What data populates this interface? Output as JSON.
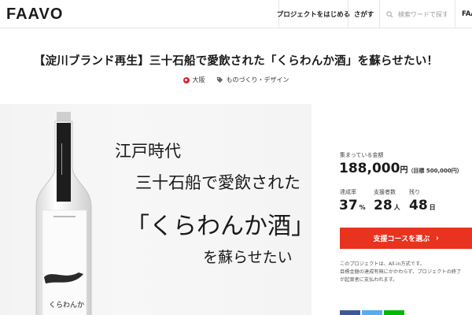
{
  "header": {
    "logo": "FAAVO",
    "nav": {
      "start_project": "プロジェクトをはじめる",
      "search": "さがす",
      "search_placeholder": "検索ワードで探す",
      "brand_cut": "FAAV"
    }
  },
  "project": {
    "title": "【淀川ブランド再生】三十石船で愛飲された「くらわんか酒」を蘇らせたい！",
    "location": "大阪",
    "category": "ものづくり・デザイン"
  },
  "hero": {
    "line1": "江戸時代",
    "line2": "三十石船で愛飲された",
    "line3": "「くらわんか酒」",
    "line4": "を蘇らせたい",
    "bottle_label": "くらわんか"
  },
  "funding": {
    "funded_label": "集まっている金額",
    "amount": "188,000",
    "yen": "円",
    "goal": "（目標 500,000円）",
    "achievement_label": "達成率",
    "achievement_value": "37",
    "achievement_unit": "%",
    "supporters_label": "支援者数",
    "supporters_value": "28",
    "supporters_unit": "人",
    "remaining_label": "残り",
    "remaining_value": "48",
    "remaining_unit": "日",
    "support_button": "支援コースを選ぶ",
    "note_line1": "このプロジェクトは、All-in方式です。",
    "note_line2": "目標金額の達成有無にかかわらず、プロジェクトの終了",
    "note_line3": "が起案者に支払われます。"
  },
  "colors": {
    "accent": "#e8331e",
    "logo_green": "#8ac43f",
    "pin_red": "#d8262c"
  }
}
